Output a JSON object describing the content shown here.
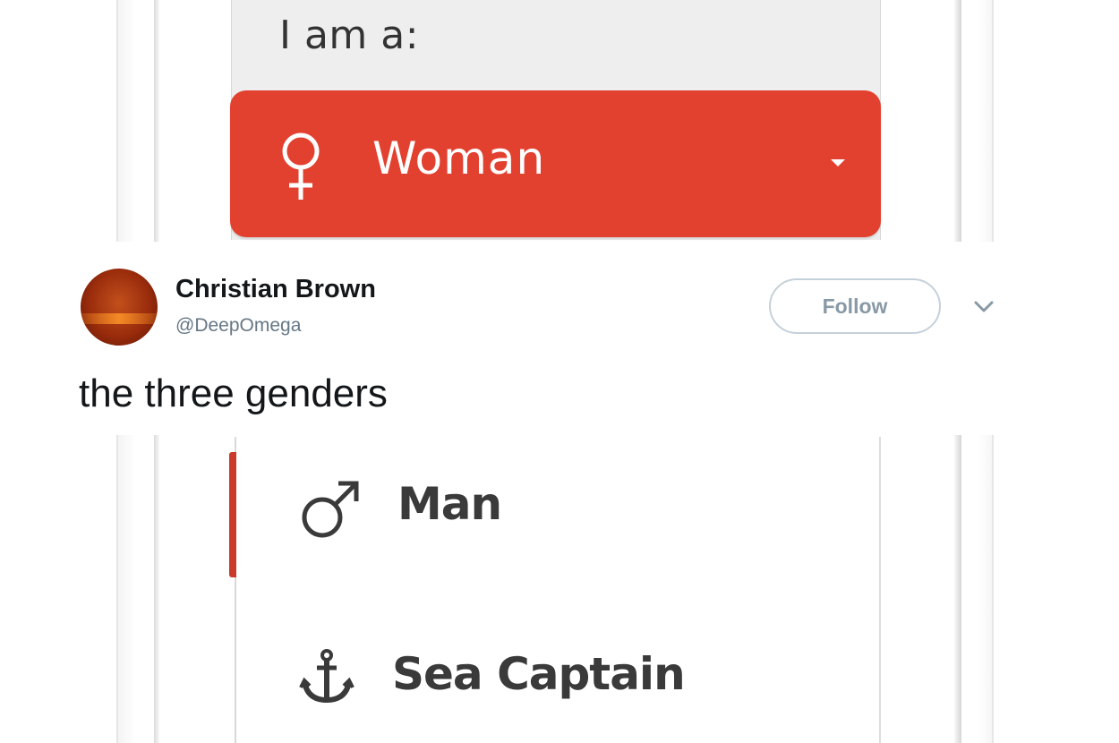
{
  "form": {
    "prompt": "I am a:",
    "selected": {
      "label": "Woman",
      "icon": "female-symbol",
      "color": "#e34130"
    }
  },
  "tweet": {
    "author": {
      "name": "Christian Brown",
      "handle": "@DeepOmega"
    },
    "follow_label": "Follow",
    "text": "the three genders"
  },
  "dropdown": {
    "options": [
      {
        "label": "Man",
        "icon": "male-symbol"
      },
      {
        "label": "Sea Captain",
        "icon": "anchor"
      }
    ]
  }
}
